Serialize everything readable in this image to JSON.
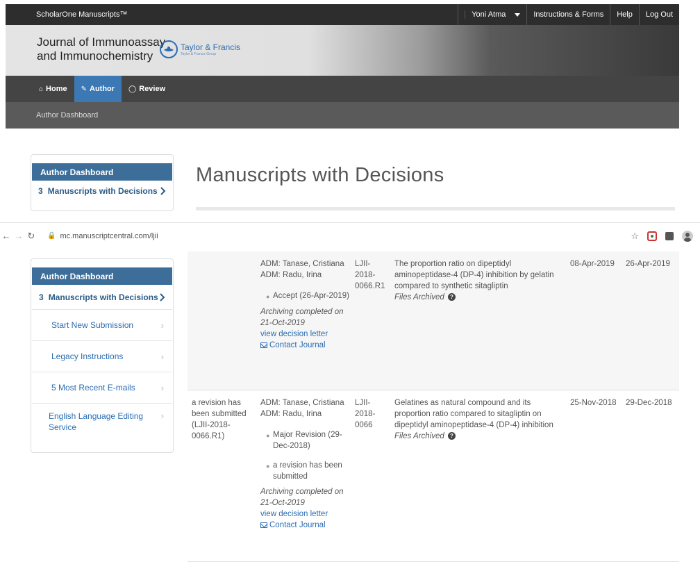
{
  "topbar": {
    "brand": "ScholarOne Manuscripts™",
    "user": "Yoni Atma",
    "instructions": "Instructions & Forms",
    "help": "Help",
    "logout": "Log Out"
  },
  "header": {
    "journal_line1": "Journal of Immunoassay",
    "journal_line2": "and Immunochemistry",
    "publisher": "Taylor & Francis",
    "publisher_sub": "Taylor & Francis Group"
  },
  "nav": {
    "home": "Home",
    "author": "Author",
    "review": "Review"
  },
  "subnav": {
    "label": "Author Dashboard"
  },
  "page": {
    "title": "Manuscripts with Decisions"
  },
  "browser": {
    "url": "mc.manuscriptcentral.com/ljii"
  },
  "sidebar": {
    "heading": "Author Dashboard",
    "main_count": "3",
    "main_label": "Manuscripts with Decisions",
    "links": [
      "Start New Submission",
      "Legacy Instructions",
      "5 Most Recent E-mails",
      "English Language Editing Service"
    ]
  },
  "table": {
    "rows": [
      {
        "status": "",
        "adm1": "ADM: Tanase, Cristiana",
        "adm2": "ADM: Radu, Irina",
        "decisions": [
          "Accept (26-Apr-2019)"
        ],
        "archiving": "Archiving completed on 21-Oct-2019",
        "view_letter": "view decision letter",
        "contact": "Contact Journal",
        "id": "LJII-2018-0066.R1",
        "title": "The proportion ratio on dipeptidyl aminopeptidase-4 (DP-4) inhibition by gelatin compared to synthetic sitagliptin",
        "files": "Files Archived",
        "submitted": "08-Apr-2019",
        "decisioned": "26-Apr-2019"
      },
      {
        "status": "a revision has been submitted (LJII-2018-0066.R1)",
        "adm1": "ADM: Tanase, Cristiana",
        "adm2": "ADM: Radu, Irina",
        "decisions": [
          "Major Revision (29-Dec-2018)",
          "a revision has been submitted"
        ],
        "archiving": "Archiving completed on 21-Oct-2019",
        "view_letter": "view decision letter",
        "contact": "Contact Journal",
        "id": "LJII-2018-0066",
        "title": "Gelatines as natural compound and its proportion ratio compared to sitagliptin on dipeptidyl aminopeptidase-4 (DP-4) inhibition",
        "files": "Files Archived",
        "submitted": "25-Nov-2018",
        "decisioned": "29-Dec-2018"
      }
    ]
  }
}
